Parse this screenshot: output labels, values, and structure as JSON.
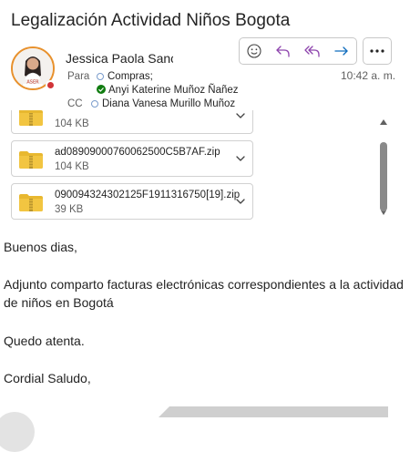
{
  "email": {
    "subject": "Legalización Actividad Niños Bogota",
    "sender": {
      "name": "Jessica Paola Sanc",
      "avatar_caption": "ASER"
    },
    "time": "10:42 a. m.",
    "to_label": "Para",
    "to": [
      "Compras;",
      "Anyi Katerine Muñoz Ñañez"
    ],
    "cc_label": "CC",
    "cc": [
      "Diana Vanesa Murillo Muñoz"
    ]
  },
  "actions": {
    "icons": [
      "emoji-icon",
      "reply-icon",
      "reply-all-icon",
      "forward-icon",
      "more-icon"
    ]
  },
  "attachments": [
    {
      "name": "",
      "size": "104 KB"
    },
    {
      "name": "ad08909000760062500C5B7AF.zip",
      "size": "104 KB"
    },
    {
      "name": "090094324302125F1911316750[19].zip",
      "size": "39 KB"
    }
  ],
  "body": {
    "greeting": "Buenos dias,",
    "message": "Adjunto comparto facturas electrónicas correspondientes a la actividad de niños en Bogotá",
    "closing": "Quedo atenta.",
    "signoff": "Cordial Saludo,"
  },
  "colors": {
    "accent": "#0f6cbd",
    "reply_purple": "#8e44ad",
    "presence_busy": "#d13438",
    "recipient_available": "#107c10",
    "zip_folder": "#f2c541"
  }
}
